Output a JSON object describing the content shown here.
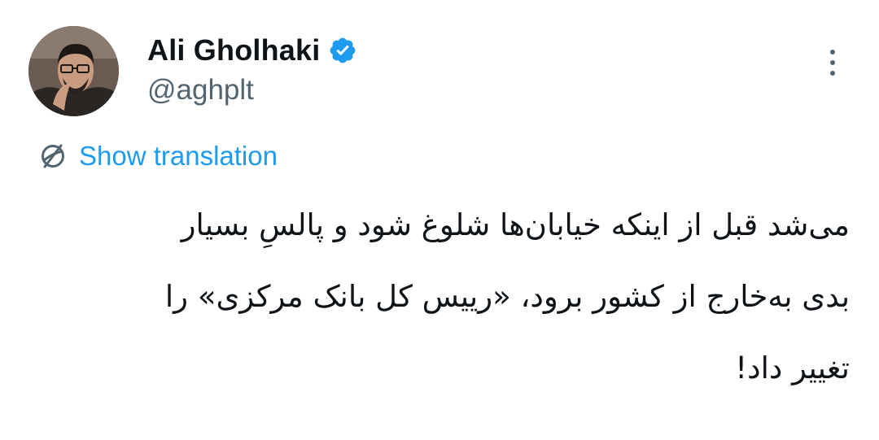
{
  "author": {
    "display_name": "Ali Gholhaki",
    "handle": "@aghplt",
    "verified": true,
    "avatar_icon": "profile-photo"
  },
  "actions": {
    "more_icon": "more-vertical-icon",
    "translate_icon": "globe-icon",
    "translate_label": "Show translation"
  },
  "tweet": {
    "lines": [
      "می‌شد قبل از اینکه خیابان‌ها شلوغ شود و پالسِ بسیار",
      "بدی به‌خارج از کشور برود، «رییس کل بانک مرکزی» را",
      "تغییر داد!"
    ]
  },
  "colors": {
    "accent": "#1d9bf0",
    "text": "#0f1419",
    "secondary": "#536471",
    "badge": "#1d9bf0"
  }
}
